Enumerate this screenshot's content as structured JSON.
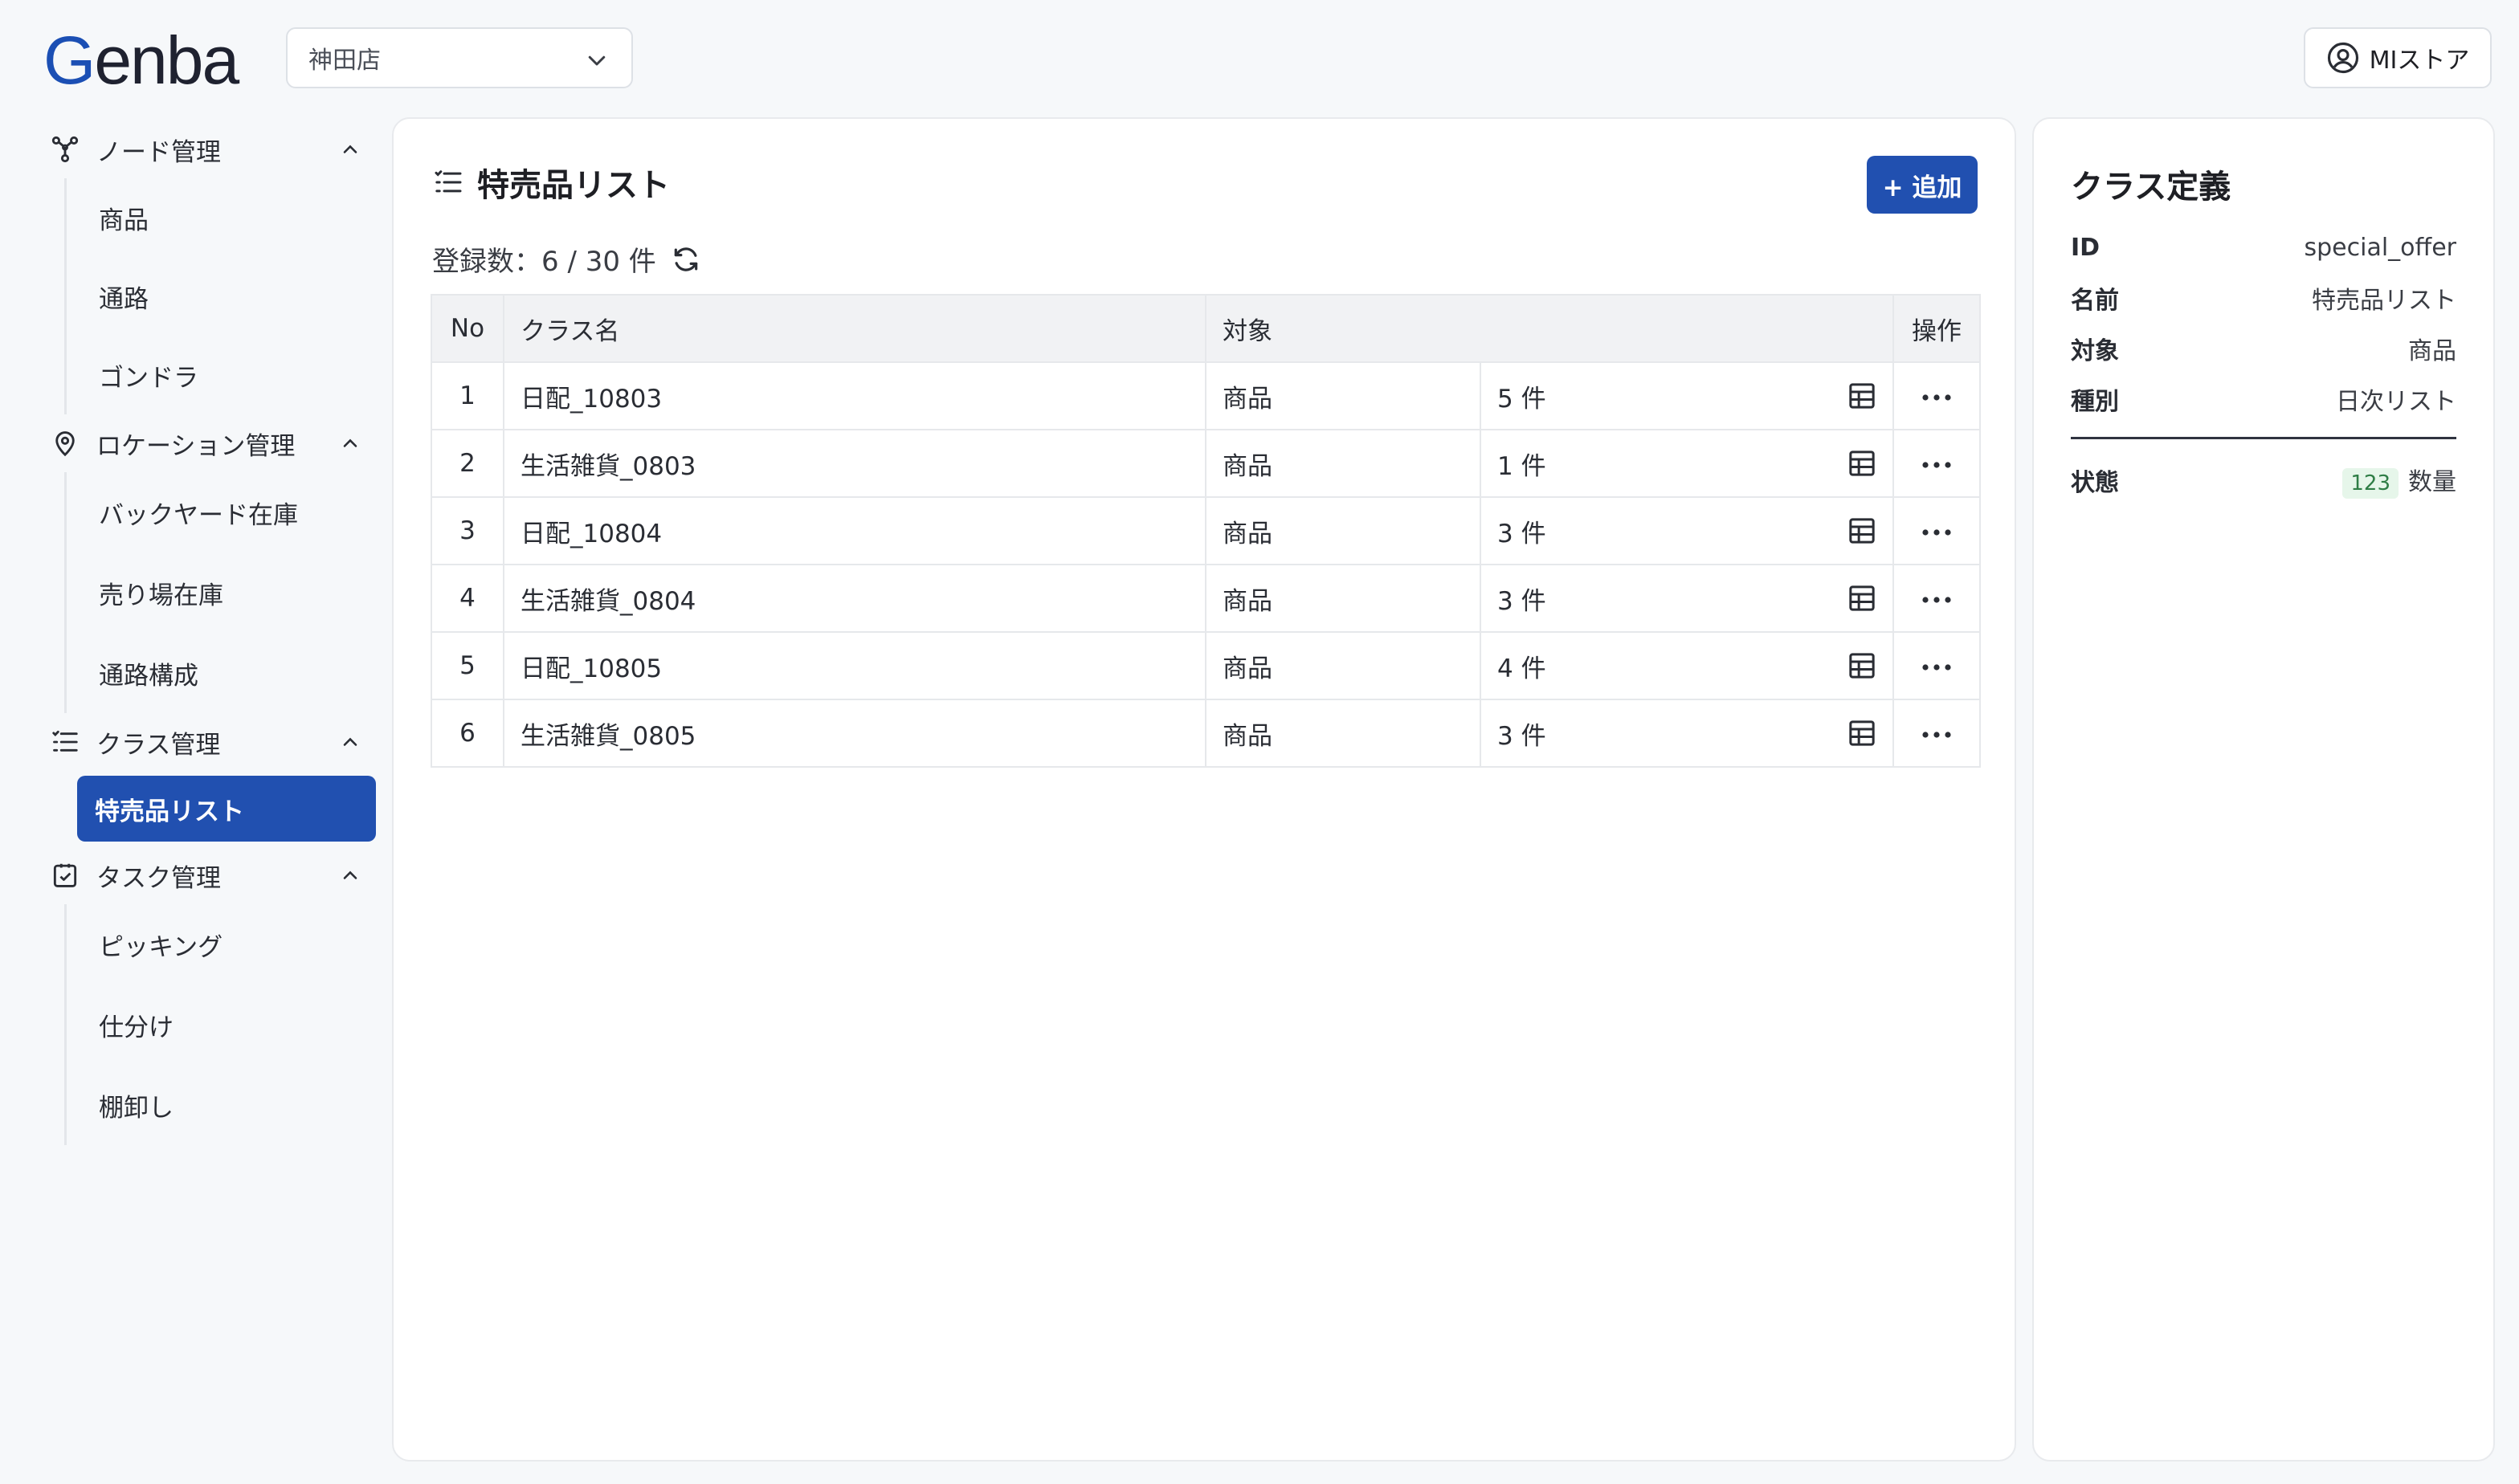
{
  "app": {
    "logo": "Genba",
    "store_select": "神田店",
    "user_label": "MIストア"
  },
  "sidebar": {
    "groups": [
      {
        "label": "ノード管理",
        "icon": "nodes-icon",
        "items": [
          "商品",
          "通路",
          "ゴンドラ"
        ]
      },
      {
        "label": "ロケーション管理",
        "icon": "location-pin-icon",
        "items": [
          "バックヤード在庫",
          "売り場在庫",
          "通路構成"
        ]
      },
      {
        "label": "クラス管理",
        "icon": "list-icon",
        "items": [
          "特売品リスト"
        ],
        "active": "特売品リスト"
      },
      {
        "label": "タスク管理",
        "icon": "task-check-icon",
        "items": [
          "ピッキング",
          "仕分け",
          "棚卸し"
        ]
      }
    ]
  },
  "main": {
    "title": "特売品リスト",
    "add_button": "+ 追加",
    "count_text": "登録数：6 / 30 件",
    "table": {
      "headers": {
        "no": "No",
        "class_name": "クラス名",
        "target": "対象",
        "ops": "操作"
      },
      "rows": [
        {
          "no": "1",
          "name": "日配_10803",
          "target": "商品",
          "count": "5 件"
        },
        {
          "no": "2",
          "name": "生活雑貨_0803",
          "target": "商品",
          "count": "1 件"
        },
        {
          "no": "3",
          "name": "日配_10804",
          "target": "商品",
          "count": "3 件"
        },
        {
          "no": "4",
          "name": "生活雑貨_0804",
          "target": "商品",
          "count": "3 件"
        },
        {
          "no": "5",
          "name": "日配_10805",
          "target": "商品",
          "count": "4 件"
        },
        {
          "no": "6",
          "name": "生活雑貨_0805",
          "target": "商品",
          "count": "3 件"
        }
      ]
    }
  },
  "class_definition": {
    "title": "クラス定義",
    "fields": [
      {
        "key": "ID",
        "value": "special_offer"
      },
      {
        "key": "名前",
        "value": "特売品リスト"
      },
      {
        "key": "対象",
        "value": "商品"
      },
      {
        "key": "種別",
        "value": "日次リスト"
      }
    ],
    "status": {
      "key": "状態",
      "badge": "123",
      "value": "数量"
    }
  },
  "colors": {
    "accent": "#2150b0",
    "badge_bg": "#e6f6ea",
    "badge_fg": "#2f7d46"
  }
}
